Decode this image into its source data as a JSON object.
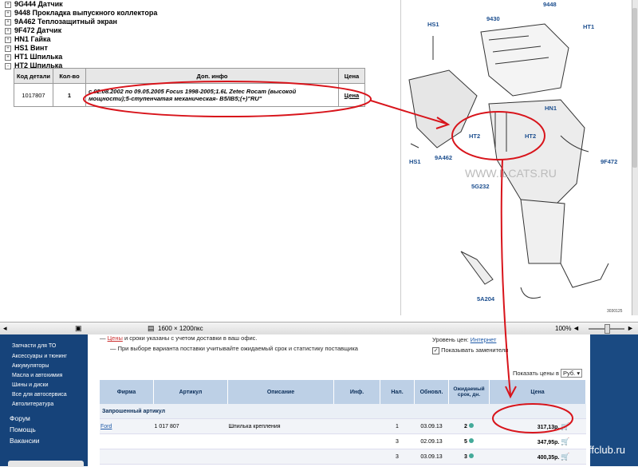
{
  "tree": {
    "items": [
      {
        "box": "+",
        "label": "9G444  Датчик"
      },
      {
        "box": "+",
        "label": "9448  Прокладка выпускного коллектора"
      },
      {
        "box": "+",
        "label": "9A462  Теплозащитный экран"
      },
      {
        "box": "+",
        "label": "9F472  Датчик"
      },
      {
        "box": "+",
        "label": "HN1  Гайка"
      },
      {
        "box": "+",
        "label": "HS1  Винт"
      },
      {
        "box": "+",
        "label": "HT1  Шпилька"
      },
      {
        "box": "-",
        "label": "HT2  Шпилька"
      }
    ]
  },
  "parts_table": {
    "headers": [
      "Код детали",
      "Кол-во",
      "Доп. инфо",
      "Цена"
    ],
    "row": {
      "code": "1017807",
      "qty": "1",
      "info": "с 02.08.2002 по 09.05.2005   Focus 1998-2005;1.6L Zetec Rocam (высокой мощности);5-ступенчатая механическая- B5/IB5;(+)\"RU\"",
      "price_link": "Цена"
    }
  },
  "diagram": {
    "labels": {
      "hs1_top": "HS1",
      "n9430": "9430",
      "n9448": "9448",
      "ht1": "HT1",
      "hn1": "HN1",
      "ht2_left": "HT2",
      "ht2_right": "HT2",
      "hs1_bottom": "HS1",
      "n9a462": "9A462",
      "n9f472": "9F472",
      "n5g232": "5G232",
      "n5a204": "5A204",
      "watermark": "WWW.ILCATS.RU",
      "fig_code": "3030125"
    }
  },
  "statusbar": {
    "dimensions": "1600 × 1200пкс",
    "zoom": "100%"
  },
  "sidebar": {
    "items": [
      "Запчасти для ТО",
      "Аксессуары и тюнинг",
      "Аккумуляторы",
      "Масла и автохимия",
      "Шины и диски",
      "Все для автосервиса",
      "Автолитература"
    ],
    "main_links": [
      "Форум",
      "Помощь",
      "Вакансии"
    ]
  },
  "notes": {
    "line1_prefix": "— ",
    "line1_price_word": "Цены",
    "line1_rest": " и сроки указаны с учетом доставки в ваш офис.",
    "line1_link": "Подробнее",
    "line2": "— При выборе варианта поставки учитывайте ожидаемый срок и статистику поставщика",
    "line2_link": "",
    "supply_level_label": "Уровень цен: ",
    "supply_level_value": "Интернет",
    "show_replacements": "Показывать заменители",
    "show_prices_in": "Показать цены в",
    "currency": "Руб."
  },
  "results": {
    "headers": [
      "Фирма",
      "Артикул",
      "Описание",
      "Инф.",
      "Нал.",
      "Обновл.",
      "Ожидаемый срок, дн.",
      "Цена"
    ],
    "group_label": "Запрошенный артикул",
    "rows": [
      {
        "firm": "Ford",
        "article": "1 017 807",
        "description": "Шпилька крепления",
        "qty": "1",
        "updated": "03.09.13",
        "term": "2",
        "price": "317,13р."
      },
      {
        "firm": "",
        "article": "",
        "description": "",
        "qty": "3",
        "updated": "02.09.13",
        "term": "5",
        "price": "347,95р."
      },
      {
        "firm": "",
        "article": "",
        "description": "",
        "qty": "3",
        "updated": "03.09.13",
        "term": "3",
        "price": "400,35р."
      }
    ]
  },
  "footer_watermark": "ffclub.ru",
  "colors": {
    "annotation_red": "#d8141b",
    "sidebar_blue": "#16437a",
    "header_blue": "#bdd0e6"
  }
}
